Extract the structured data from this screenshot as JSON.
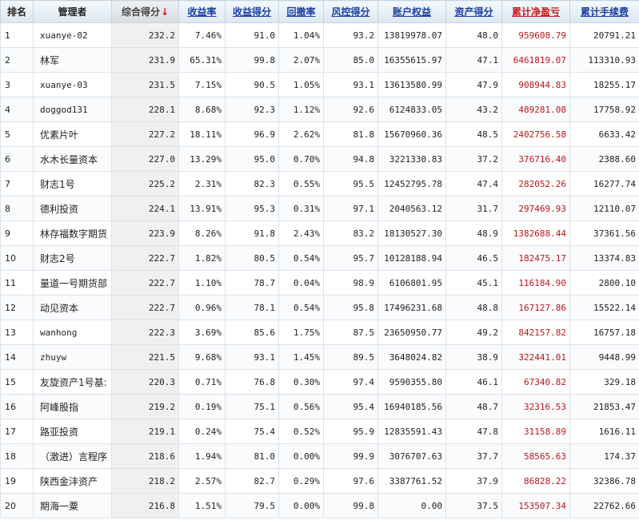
{
  "header": {
    "rank": "排名",
    "manager": "管理者",
    "total_score": "综合得分",
    "sort_arrow": "↓",
    "return_rate": "收益率",
    "return_score": "收益得分",
    "drawdown": "回撤率",
    "risk_score": "风控得分",
    "equity": "账户权益",
    "asset_score": "资产得分",
    "net_pnl": "累计净盈亏",
    "fees": "累计手续费"
  },
  "colors": {
    "link_blue": "#1a3fa0",
    "pnl_red": "#b8151b",
    "sort_arrow_red": "#d01616"
  },
  "rows": [
    {
      "rank": "1",
      "manager": "xuanye-02",
      "total": "232.2",
      "rate": "7.46%",
      "ret_score": "91.0",
      "drawdown": "1.04%",
      "risk": "93.2",
      "equity": "13819978.07",
      "asset": "48.0",
      "pnl": "959608.79",
      "fee": "20791.21"
    },
    {
      "rank": "2",
      "manager": "林军",
      "total": "231.9",
      "rate": "65.31%",
      "ret_score": "99.8",
      "drawdown": "2.07%",
      "risk": "85.0",
      "equity": "16355615.97",
      "asset": "47.1",
      "pnl": "6461819.07",
      "fee": "113310.93"
    },
    {
      "rank": "3",
      "manager": "xuanye-03",
      "total": "231.5",
      "rate": "7.15%",
      "ret_score": "90.5",
      "drawdown": "1.05%",
      "risk": "93.1",
      "equity": "13613580.99",
      "asset": "47.9",
      "pnl": "908944.83",
      "fee": "18255.17"
    },
    {
      "rank": "4",
      "manager": "doggod131",
      "total": "228.1",
      "rate": "8.68%",
      "ret_score": "92.3",
      "drawdown": "1.12%",
      "risk": "92.6",
      "equity": "6124833.05",
      "asset": "43.2",
      "pnl": "489281.08",
      "fee": "17758.92"
    },
    {
      "rank": "5",
      "manager": "优素片叶",
      "total": "227.2",
      "rate": "18.11%",
      "ret_score": "96.9",
      "drawdown": "2.62%",
      "risk": "81.8",
      "equity": "15670960.36",
      "asset": "48.5",
      "pnl": "2402756.58",
      "fee": "6633.42"
    },
    {
      "rank": "6",
      "manager": "水木长量资本",
      "total": "227.0",
      "rate": "13.29%",
      "ret_score": "95.0",
      "drawdown": "0.70%",
      "risk": "94.8",
      "equity": "3221330.83",
      "asset": "37.2",
      "pnl": "376716.40",
      "fee": "2388.60"
    },
    {
      "rank": "7",
      "manager": "财志1号",
      "total": "225.2",
      "rate": "2.31%",
      "ret_score": "82.3",
      "drawdown": "0.55%",
      "risk": "95.5",
      "equity": "12452795.78",
      "asset": "47.4",
      "pnl": "282052.26",
      "fee": "16277.74"
    },
    {
      "rank": "8",
      "manager": "德利投资",
      "total": "224.1",
      "rate": "13.91%",
      "ret_score": "95.3",
      "drawdown": "0.31%",
      "risk": "97.1",
      "equity": "2040563.12",
      "asset": "31.7",
      "pnl": "297469.93",
      "fee": "12110.07"
    },
    {
      "rank": "9",
      "manager": "林存福数字期货",
      "total": "223.9",
      "rate": "8.26%",
      "ret_score": "91.8",
      "drawdown": "2.43%",
      "risk": "83.2",
      "equity": "18130527.30",
      "asset": "48.9",
      "pnl": "1382688.44",
      "fee": "37361.56"
    },
    {
      "rank": "10",
      "manager": "财志2号",
      "total": "222.7",
      "rate": "1.82%",
      "ret_score": "80.5",
      "drawdown": "0.54%",
      "risk": "95.7",
      "equity": "10128188.94",
      "asset": "46.5",
      "pnl": "182475.17",
      "fee": "13374.83"
    },
    {
      "rank": "11",
      "manager": "量道一号期货部",
      "total": "222.7",
      "rate": "1.10%",
      "ret_score": "78.7",
      "drawdown": "0.04%",
      "risk": "98.9",
      "equity": "6106801.95",
      "asset": "45.1",
      "pnl": "116184.90",
      "fee": "2800.10"
    },
    {
      "rank": "12",
      "manager": "动见资本",
      "total": "222.7",
      "rate": "0.96%",
      "ret_score": "78.1",
      "drawdown": "0.54%",
      "risk": "95.8",
      "equity": "17496231.68",
      "asset": "48.8",
      "pnl": "167127.86",
      "fee": "15522.14"
    },
    {
      "rank": "13",
      "manager": "wanhong",
      "total": "222.3",
      "rate": "3.69%",
      "ret_score": "85.6",
      "drawdown": "1.75%",
      "risk": "87.5",
      "equity": "23650950.77",
      "asset": "49.2",
      "pnl": "842157.82",
      "fee": "16757.18"
    },
    {
      "rank": "14",
      "manager": "zhuyw",
      "total": "221.5",
      "rate": "9.68%",
      "ret_score": "93.1",
      "drawdown": "1.45%",
      "risk": "89.5",
      "equity": "3648024.82",
      "asset": "38.9",
      "pnl": "322441.01",
      "fee": "9448.99"
    },
    {
      "rank": "15",
      "manager": "友旋资产1号基:",
      "total": "220.3",
      "rate": "0.71%",
      "ret_score": "76.8",
      "drawdown": "0.30%",
      "risk": "97.4",
      "equity": "9590355.80",
      "asset": "46.1",
      "pnl": "67340.82",
      "fee": "329.18"
    },
    {
      "rank": "16",
      "manager": "阿峰股指",
      "total": "219.2",
      "rate": "0.19%",
      "ret_score": "75.1",
      "drawdown": "0.56%",
      "risk": "95.4",
      "equity": "16940185.56",
      "asset": "48.7",
      "pnl": "32316.53",
      "fee": "21853.47"
    },
    {
      "rank": "17",
      "manager": "路亚投资",
      "total": "219.1",
      "rate": "0.24%",
      "ret_score": "75.4",
      "drawdown": "0.52%",
      "risk": "95.9",
      "equity": "12835591.43",
      "asset": "47.8",
      "pnl": "31158.89",
      "fee": "1616.11"
    },
    {
      "rank": "18",
      "manager": "（激进）言程序",
      "total": "218.6",
      "rate": "1.94%",
      "ret_score": "81.0",
      "drawdown": "0.00%",
      "risk": "99.9",
      "equity": "3076707.63",
      "asset": "37.7",
      "pnl": "58565.63",
      "fee": "174.37"
    },
    {
      "rank": "19",
      "manager": "陕西金沣资产",
      "total": "218.2",
      "rate": "2.57%",
      "ret_score": "82.7",
      "drawdown": "0.29%",
      "risk": "97.6",
      "equity": "3387761.52",
      "asset": "37.9",
      "pnl": "86828.22",
      "fee": "32386.78"
    },
    {
      "rank": "20",
      "manager": "期海一粟",
      "total": "216.8",
      "rate": "1.51%",
      "ret_score": "79.5",
      "drawdown": "0.00%",
      "risk": "99.8",
      "equity": "0.00",
      "asset": "37.5",
      "pnl": "153507.34",
      "fee": "22762.66"
    }
  ]
}
